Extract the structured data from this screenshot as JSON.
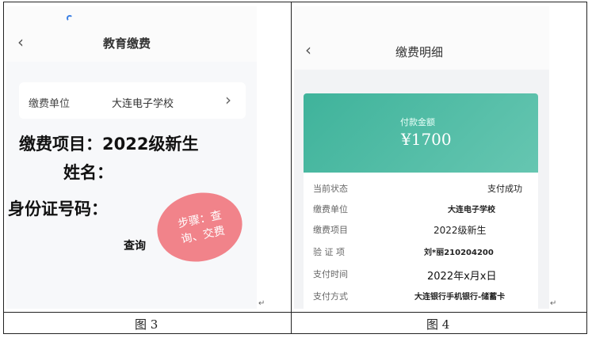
{
  "figure3": {
    "nav_title": "教育缴费",
    "unit_label": "缴费单位",
    "unit_value": "大连电子学校",
    "project_line": "缴费项目：2022级新生",
    "name_line": "姓名：",
    "id_line": "身份证号码：",
    "stamp_text": "步骤：查询、交费",
    "query_label": "查询",
    "caption": "图 3"
  },
  "figure4": {
    "nav_title": "缴费明细",
    "amount_label": "付款金额",
    "amount": "¥1700",
    "rows": [
      {
        "k": "当前状态",
        "v": "支付成功"
      },
      {
        "k": "缴费单位",
        "v": "大连电子学校"
      },
      {
        "k": "缴费项目",
        "v": "2022级新生"
      },
      {
        "k": "验 证 项",
        "v": "刘*丽210204200"
      },
      {
        "k": "支付时间",
        "v": "2022年x月x日"
      },
      {
        "k": "支付方式",
        "v": "大连银行手机银行-储蓄卡"
      }
    ],
    "caption": "图 4"
  },
  "para_mark": "↵"
}
